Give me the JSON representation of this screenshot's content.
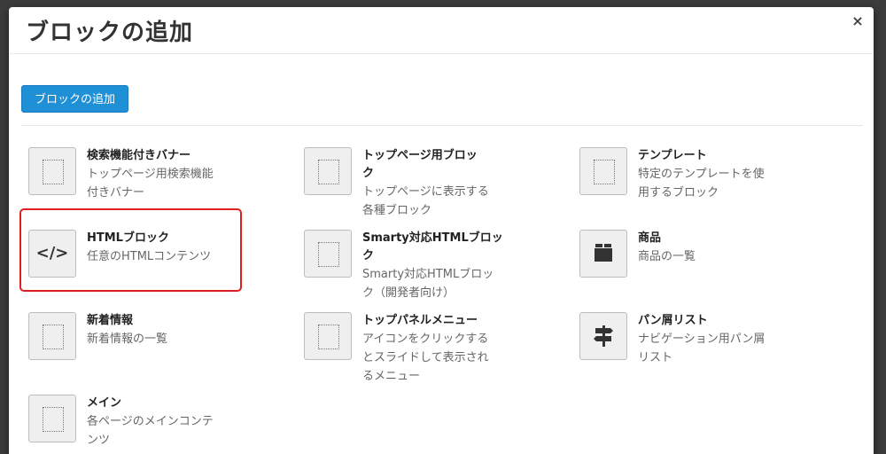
{
  "modal": {
    "title": "ブロックの追加",
    "close_label": "×",
    "add_button_label": "ブロックの追加"
  },
  "blocks": [
    {
      "name": "検索機能付きバナー",
      "desc": "トップページ用検索機能付きバナー",
      "icon": "dotted-square-icon"
    },
    {
      "name": "トップページ用ブロック",
      "desc": "トップページに表示する各種ブロック",
      "icon": "dotted-square-icon"
    },
    {
      "name": "テンプレート",
      "desc": "特定のテンプレートを使用するブロック",
      "icon": "dotted-square-icon"
    },
    {
      "name": "HTMLブロック",
      "desc": "任意のHTMLコンテンツ",
      "icon": "code-icon"
    },
    {
      "name": "Smarty対応HTMLブロック",
      "desc": "Smarty対応HTMLブロック（開発者向け）",
      "icon": "dotted-square-icon"
    },
    {
      "name": "商品",
      "desc": "商品の一覧",
      "icon": "box-icon"
    },
    {
      "name": "新着情報",
      "desc": "新着情報の一覧",
      "icon": "dotted-square-icon"
    },
    {
      "name": "トップパネルメニュー",
      "desc": "アイコンをクリックするとスライドして表示されるメニュー",
      "icon": "dotted-square-icon"
    },
    {
      "name": "パン屑リスト",
      "desc": "ナビゲーション用パン屑リスト",
      "icon": "signpost-icon"
    },
    {
      "name": "メイン",
      "desc": "各ページのメインコンテンツ",
      "icon": "dotted-square-icon"
    }
  ],
  "colors": {
    "accent": "#1f8fd6",
    "highlight": "#e02020"
  }
}
